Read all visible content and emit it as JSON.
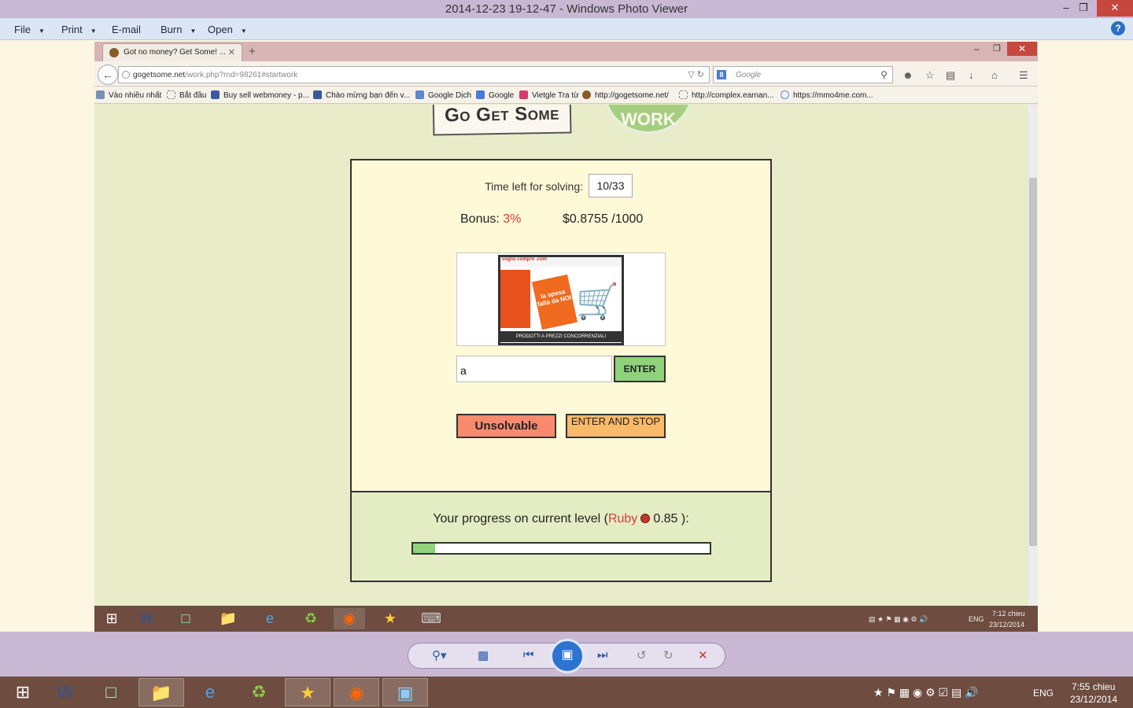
{
  "viewer": {
    "title": "2014-12-23 19-12-47 - Windows Photo Viewer",
    "menu": {
      "file": "File",
      "print": "Print",
      "email": "E-mail",
      "burn": "Burn",
      "open": "Open"
    },
    "help": "?"
  },
  "browser": {
    "tab_title": "Got no money? Get Some! ...",
    "url_host": "gogetsome.net",
    "url_path": "/work.php?rnd=98261#startwork",
    "search_placeholder": "Google",
    "bookmarks": [
      "Vào nhiều nhất",
      "Bắt đầu",
      "Buy sell webmoney - p...",
      "Chào mừng bạn đến v...",
      "Google Dịch",
      "Google",
      "Vietgle Tra từ",
      "http://gogetsome.net/",
      "http://complex.earnan...",
      "https://mmo4me.com..."
    ]
  },
  "page": {
    "logo_text": "Go Get Some",
    "work_badge": "WORK",
    "time_label": "Time left for solving:",
    "time_value": "10/33",
    "bonus_label": "Bonus:",
    "bonus_value": "3%",
    "money": "$0.8755 /1000",
    "answer_value": "a",
    "enter_label": "ENTER",
    "unsolvable_label": "Unsolvable",
    "enter_stop_label": "ENTER AND STOP",
    "captcha": {
      "header": "voglio compro .com",
      "bag_text": "la spesa falla da NOI",
      "footer": "PRODOTTI A PREZZI CONCORRENZIALI"
    },
    "progress": {
      "prefix": "Your progress on current level (",
      "level": "Ruby",
      "value": "0.85",
      "suffix": " ):",
      "fill_percent": 7.5
    }
  },
  "inner_taskbar": {
    "lang": "ENG",
    "time": "7:12 chieu",
    "date": "23/12/2014"
  },
  "taskbar": {
    "lang": "ENG",
    "time": "7:55 chieu",
    "date": "23/12/2014"
  },
  "colors": {
    "bonus": "#e03a3a",
    "enter": "#8fd27a",
    "unsolvable": "#f98a6e",
    "enter_stop": "#fbb96a",
    "page_bg": "#e8ecc8"
  }
}
